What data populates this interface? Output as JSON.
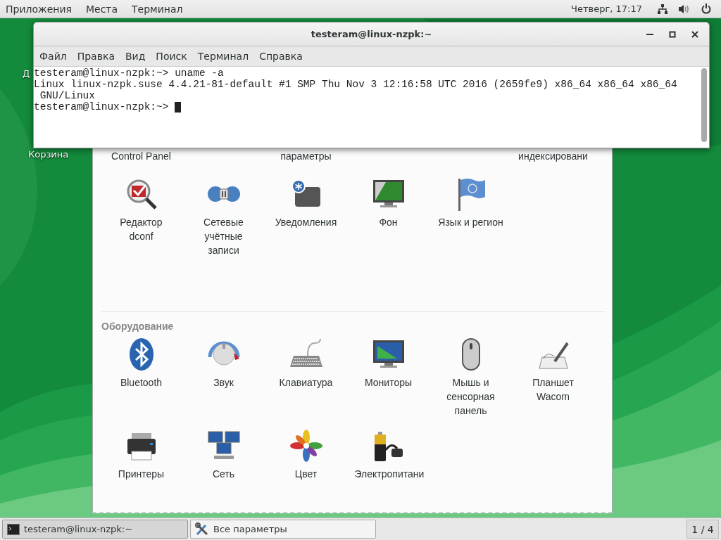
{
  "top_bar": {
    "menus": [
      "Приложения",
      "Места",
      "Терминал"
    ],
    "clock": "Четверг, 17:17"
  },
  "desktop_icons": [
    {
      "label": "Д"
    },
    {
      "label": "Корзина"
    }
  ],
  "settings_window": {
    "partial_labels": [
      "Control Panel",
      "параметры",
      "индексировани"
    ],
    "sections": [
      {
        "items": [
          "Редактор dconf",
          "Сетевые учётные записи",
          "Уведомления",
          "Фон",
          "Язык и регион"
        ]
      },
      {
        "title": "Оборудование",
        "items": [
          "Bluetooth",
          "Звук",
          "Клавиатура",
          "Мониторы",
          "Мышь и сенсорная панель",
          "Планшет Wacom",
          "Принтеры",
          "Сеть",
          "Цвет",
          "Электропитани"
        ]
      }
    ]
  },
  "terminal": {
    "title": "testeram@linux-nzpk:~",
    "menu": [
      "Файл",
      "Правка",
      "Вид",
      "Поиск",
      "Терминал",
      "Справка"
    ],
    "lines": [
      "testeram@linux-nzpk:~> uname -a",
      "Linux linux-nzpk.suse 4.4.21-81-default #1 SMP Thu Nov 3 12:16:58 UTC 2016 (2659fe9) x86_64 x86_64 x86_64",
      " GNU/Linux",
      "testeram@linux-nzpk:~> "
    ]
  },
  "taskbar": {
    "tasks": [
      {
        "label": "testeram@linux-nzpk:~",
        "selected": true
      },
      {
        "label": "Все параметры",
        "selected": false
      }
    ],
    "pager": "1 / 4"
  }
}
